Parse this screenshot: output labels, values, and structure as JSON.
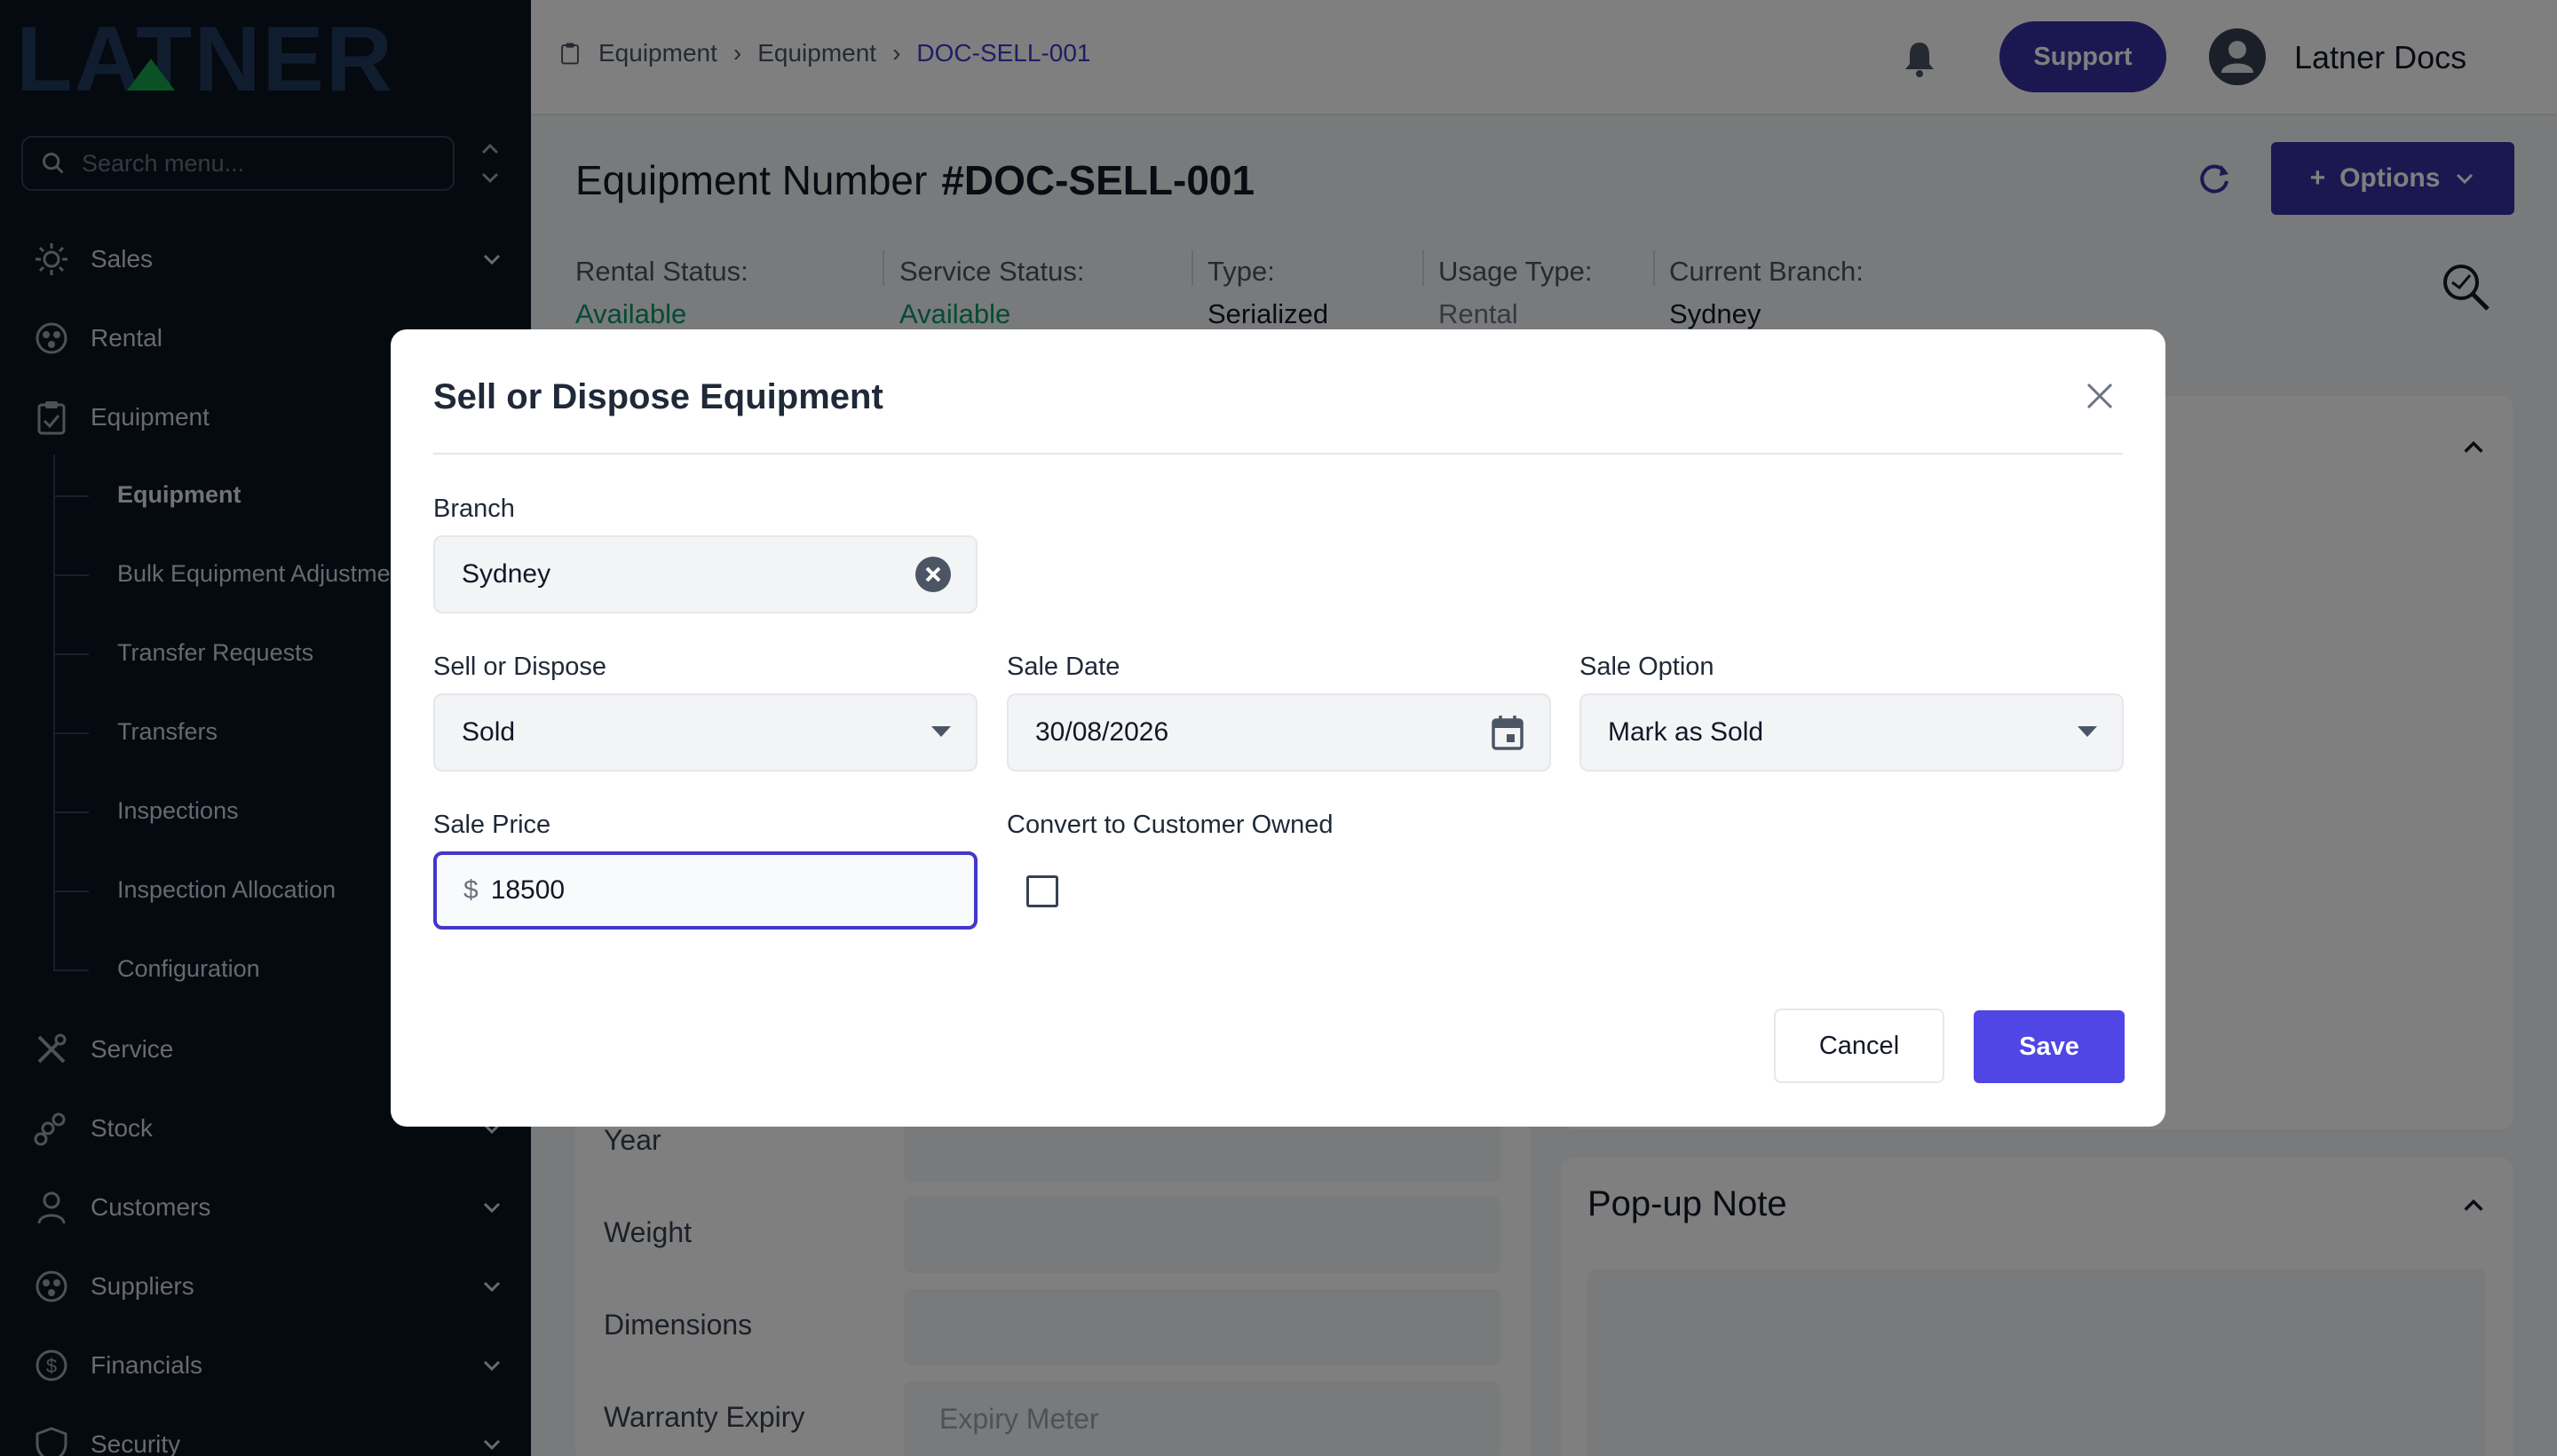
{
  "brand": {
    "logo_text": "LATNER"
  },
  "sidebar": {
    "search_placeholder": "Search menu...",
    "items": [
      {
        "label": "Sales"
      },
      {
        "label": "Rental"
      },
      {
        "label": "Equipment"
      },
      {
        "label": "Service"
      },
      {
        "label": "Stock"
      },
      {
        "label": "Customers"
      },
      {
        "label": "Suppliers"
      },
      {
        "label": "Financials"
      },
      {
        "label": "Security"
      }
    ],
    "equipment_sub": [
      {
        "label": "Equipment"
      },
      {
        "label": "Bulk Equipment Adjustments"
      },
      {
        "label": "Transfer Requests"
      },
      {
        "label": "Transfers"
      },
      {
        "label": "Inspections"
      },
      {
        "label": "Inspection Allocation"
      },
      {
        "label": "Configuration"
      }
    ]
  },
  "header": {
    "breadcrumb": [
      "Equipment",
      "Equipment",
      "DOC-SELL-001"
    ],
    "support_label": "Support",
    "user_name": "Latner Docs"
  },
  "page": {
    "title_label": "Equipment Number",
    "title_number": "#DOC-SELL-001",
    "options_label": "Options",
    "status": [
      {
        "label": "Rental Status:",
        "value": "Available"
      },
      {
        "label": "Service Status:",
        "value": "Available"
      },
      {
        "label": "Type:",
        "value": "Serialized"
      },
      {
        "label": "Usage Type:",
        "value": "Rental"
      },
      {
        "label": "Current Branch:",
        "value": "Sydney"
      }
    ],
    "fields": {
      "year": "Year",
      "weight": "Weight",
      "dimensions": "Dimensions",
      "warranty_expiry": "Warranty Expiry",
      "expiry_meter_placeholder": "Expiry Meter"
    },
    "popup_note_title": "Pop-up Note"
  },
  "modal": {
    "title": "Sell or Dispose Equipment",
    "branch": {
      "label": "Branch",
      "value": "Sydney"
    },
    "sell_or_dispose": {
      "label": "Sell or Dispose",
      "value": "Sold"
    },
    "sale_date": {
      "label": "Sale Date",
      "value": "30/08/2026"
    },
    "sale_option": {
      "label": "Sale Option",
      "value": "Mark as Sold"
    },
    "sale_price": {
      "label": "Sale Price",
      "currency": "$",
      "value": "18500"
    },
    "convert": {
      "label": "Convert to Customer Owned",
      "checked": false
    },
    "cancel_label": "Cancel",
    "save_label": "Save"
  },
  "colors": {
    "primary": "#4f46e5",
    "primary_dark": "#3730a3",
    "sidebar_bg": "#0b1220",
    "status_green": "#059669"
  }
}
